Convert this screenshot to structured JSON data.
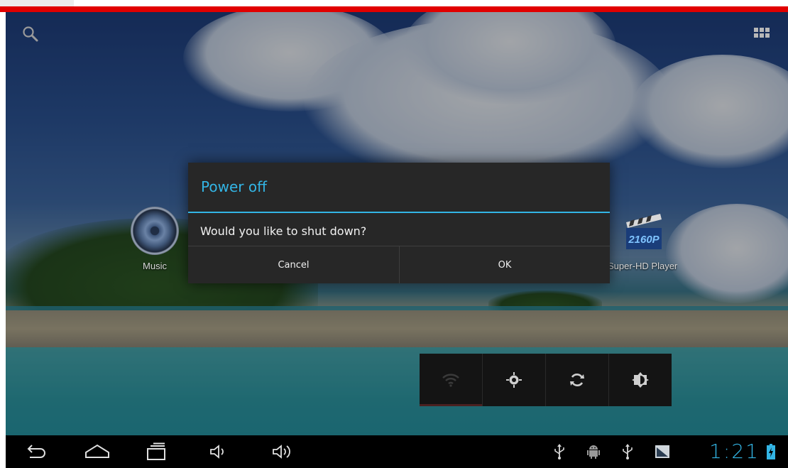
{
  "dialog": {
    "title": "Power off",
    "message": "Would you like to shut down?",
    "cancel_label": "Cancel",
    "ok_label": "OK"
  },
  "home": {
    "shortcuts": [
      {
        "label": "Music",
        "icon": "music-speaker-icon"
      },
      {
        "label": "Super-HD Player",
        "icon": "clapperboard-2160p-icon",
        "badge": "2160P"
      }
    ],
    "search_icon": "search-icon",
    "apps_icon": "all-apps-grid-icon"
  },
  "power_widget": {
    "toggles": [
      {
        "name": "wifi",
        "icon": "wifi-icon",
        "state": "off"
      },
      {
        "name": "gps",
        "icon": "location-icon",
        "state": "on"
      },
      {
        "name": "sync",
        "icon": "sync-icon",
        "state": "on"
      },
      {
        "name": "brightness",
        "icon": "brightness-icon",
        "state": "on"
      }
    ]
  },
  "navbar": {
    "buttons": [
      "back-icon",
      "home-icon",
      "recent-apps-icon",
      "volume-down-icon",
      "volume-up-icon"
    ],
    "status_icons": [
      "usb-icon",
      "android-debug-icon",
      "usb-icon",
      "screenshot-icon"
    ],
    "clock": "1:21",
    "battery_icon": "battery-charging-icon"
  },
  "colors": {
    "accent": "#33b5e5",
    "dialog_bg": "#272727",
    "top_stripe": "#e10000"
  }
}
